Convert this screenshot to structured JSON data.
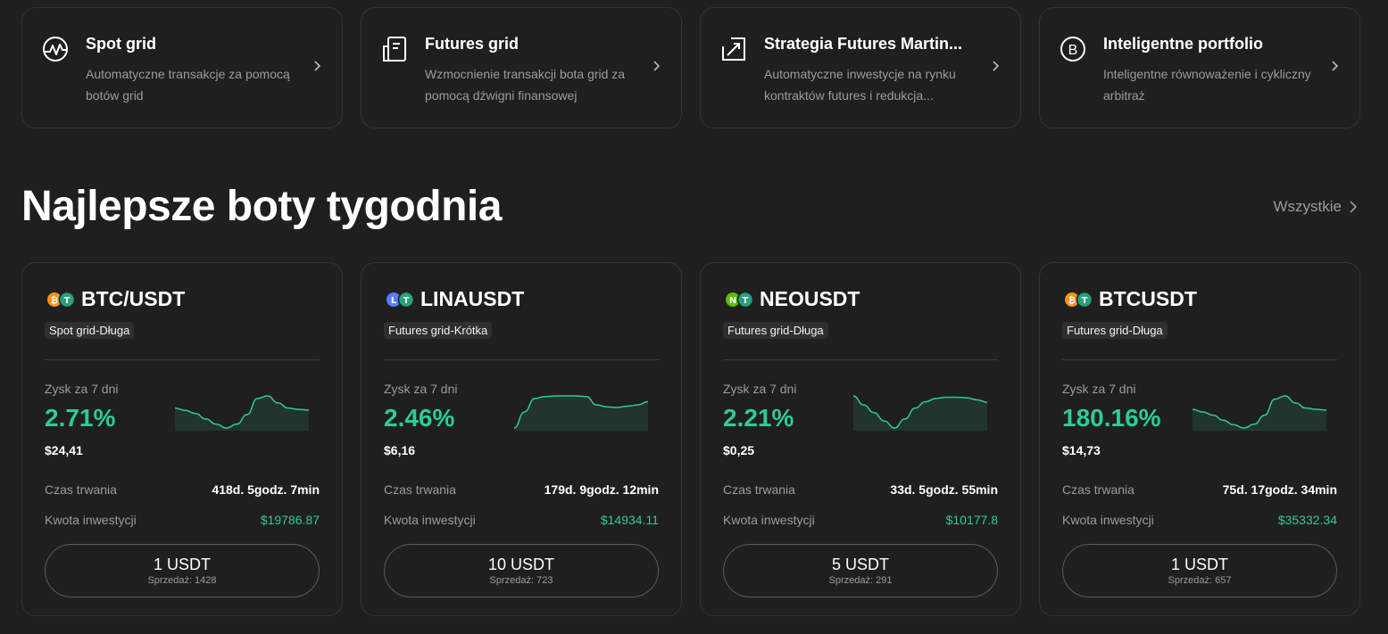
{
  "strategies": [
    {
      "title": "Spot grid",
      "desc": "Automatyczne transakcje za pomocą botów grid",
      "icon": "chart-wave-icon"
    },
    {
      "title": "Futures grid",
      "desc": "Wzmocnienie transakcji bota grid za pomocą dźwigni finansowej",
      "icon": "document-icon"
    },
    {
      "title": "Strategia Futures Martin...",
      "desc": "Automatyczne inwestycje na rynku kontraktów futures i redukcja...",
      "icon": "trend-chart-icon"
    },
    {
      "title": "Inteligentne portfolio",
      "desc": "Inteligentne równoważenie i cykliczny arbitraż",
      "icon": "coin-b-icon"
    }
  ],
  "section": {
    "title": "Najlepsze boty tygodnia",
    "see_all": "Wszystkie"
  },
  "labels": {
    "profit": "Zysk za 7 dni",
    "duration": "Czas trwania",
    "investment": "Kwota inwestycji"
  },
  "colors": {
    "accent": "#2ecc94",
    "background": "#1f1f1f",
    "border": "#333333",
    "muted": "#9c9c9c"
  },
  "bots": [
    {
      "pair": "BTC/USDT",
      "tag": "Spot grid-Długa",
      "coin_colors": [
        "#f7931a",
        "#26a17b"
      ],
      "coin_glyphs": [
        "₿",
        "T"
      ],
      "profit_pct": "2.71%",
      "profit_usd": "$24,41",
      "duration": "418d. 5godz. 7min",
      "investment": "$19786.87",
      "price": "1 USDT",
      "sold": "Sprzedaż: 1428",
      "spark": [
        0.62,
        0.55,
        0.45,
        0.28,
        0.12,
        0.0,
        0.12,
        0.42,
        0.92,
        1.0,
        0.78,
        0.62,
        0.58,
        0.56
      ]
    },
    {
      "pair": "LINAUSDT",
      "tag": "Futures grid-Krótka",
      "coin_colors": [
        "#5b7cfa",
        "#26a17b"
      ],
      "coin_glyphs": [
        "L",
        "T"
      ],
      "profit_pct": "2.46%",
      "profit_usd": "$6,16",
      "duration": "179d. 9godz. 12min",
      "investment": "$14934.11",
      "price": "10 USDT",
      "sold": "Sprzedaż: 723",
      "spark": [
        0.0,
        0.5,
        0.92,
        0.98,
        1.0,
        1.0,
        1.0,
        0.98,
        0.72,
        0.66,
        0.64,
        0.68,
        0.72,
        0.82
      ]
    },
    {
      "pair": "NEOUSDT",
      "tag": "Futures grid-Długa",
      "coin_colors": [
        "#58bf00",
        "#26a17b"
      ],
      "coin_glyphs": [
        "N",
        "T"
      ],
      "profit_pct": "2.21%",
      "profit_usd": "$0,25",
      "duration": "33d. 5godz. 55min",
      "investment": "$10177.8",
      "price": "5 USDT",
      "sold": "Sprzedaż: 291",
      "spark": [
        1.0,
        0.72,
        0.48,
        0.22,
        0.0,
        0.28,
        0.62,
        0.82,
        0.92,
        0.96,
        0.96,
        0.94,
        0.88,
        0.8
      ]
    },
    {
      "pair": "BTCUSDT",
      "tag": "Futures grid-Długa",
      "coin_colors": [
        "#f7931a",
        "#26a17b"
      ],
      "coin_glyphs": [
        "₿",
        "T"
      ],
      "profit_pct": "180.16%",
      "profit_usd": "$14,73",
      "duration": "75d. 17godz. 34min",
      "investment": "$35332.34",
      "price": "1 USDT",
      "sold": "Sprzedaż: 657",
      "spark": [
        0.58,
        0.5,
        0.4,
        0.24,
        0.1,
        0.0,
        0.12,
        0.4,
        0.9,
        1.0,
        0.78,
        0.62,
        0.58,
        0.56
      ]
    }
  ]
}
